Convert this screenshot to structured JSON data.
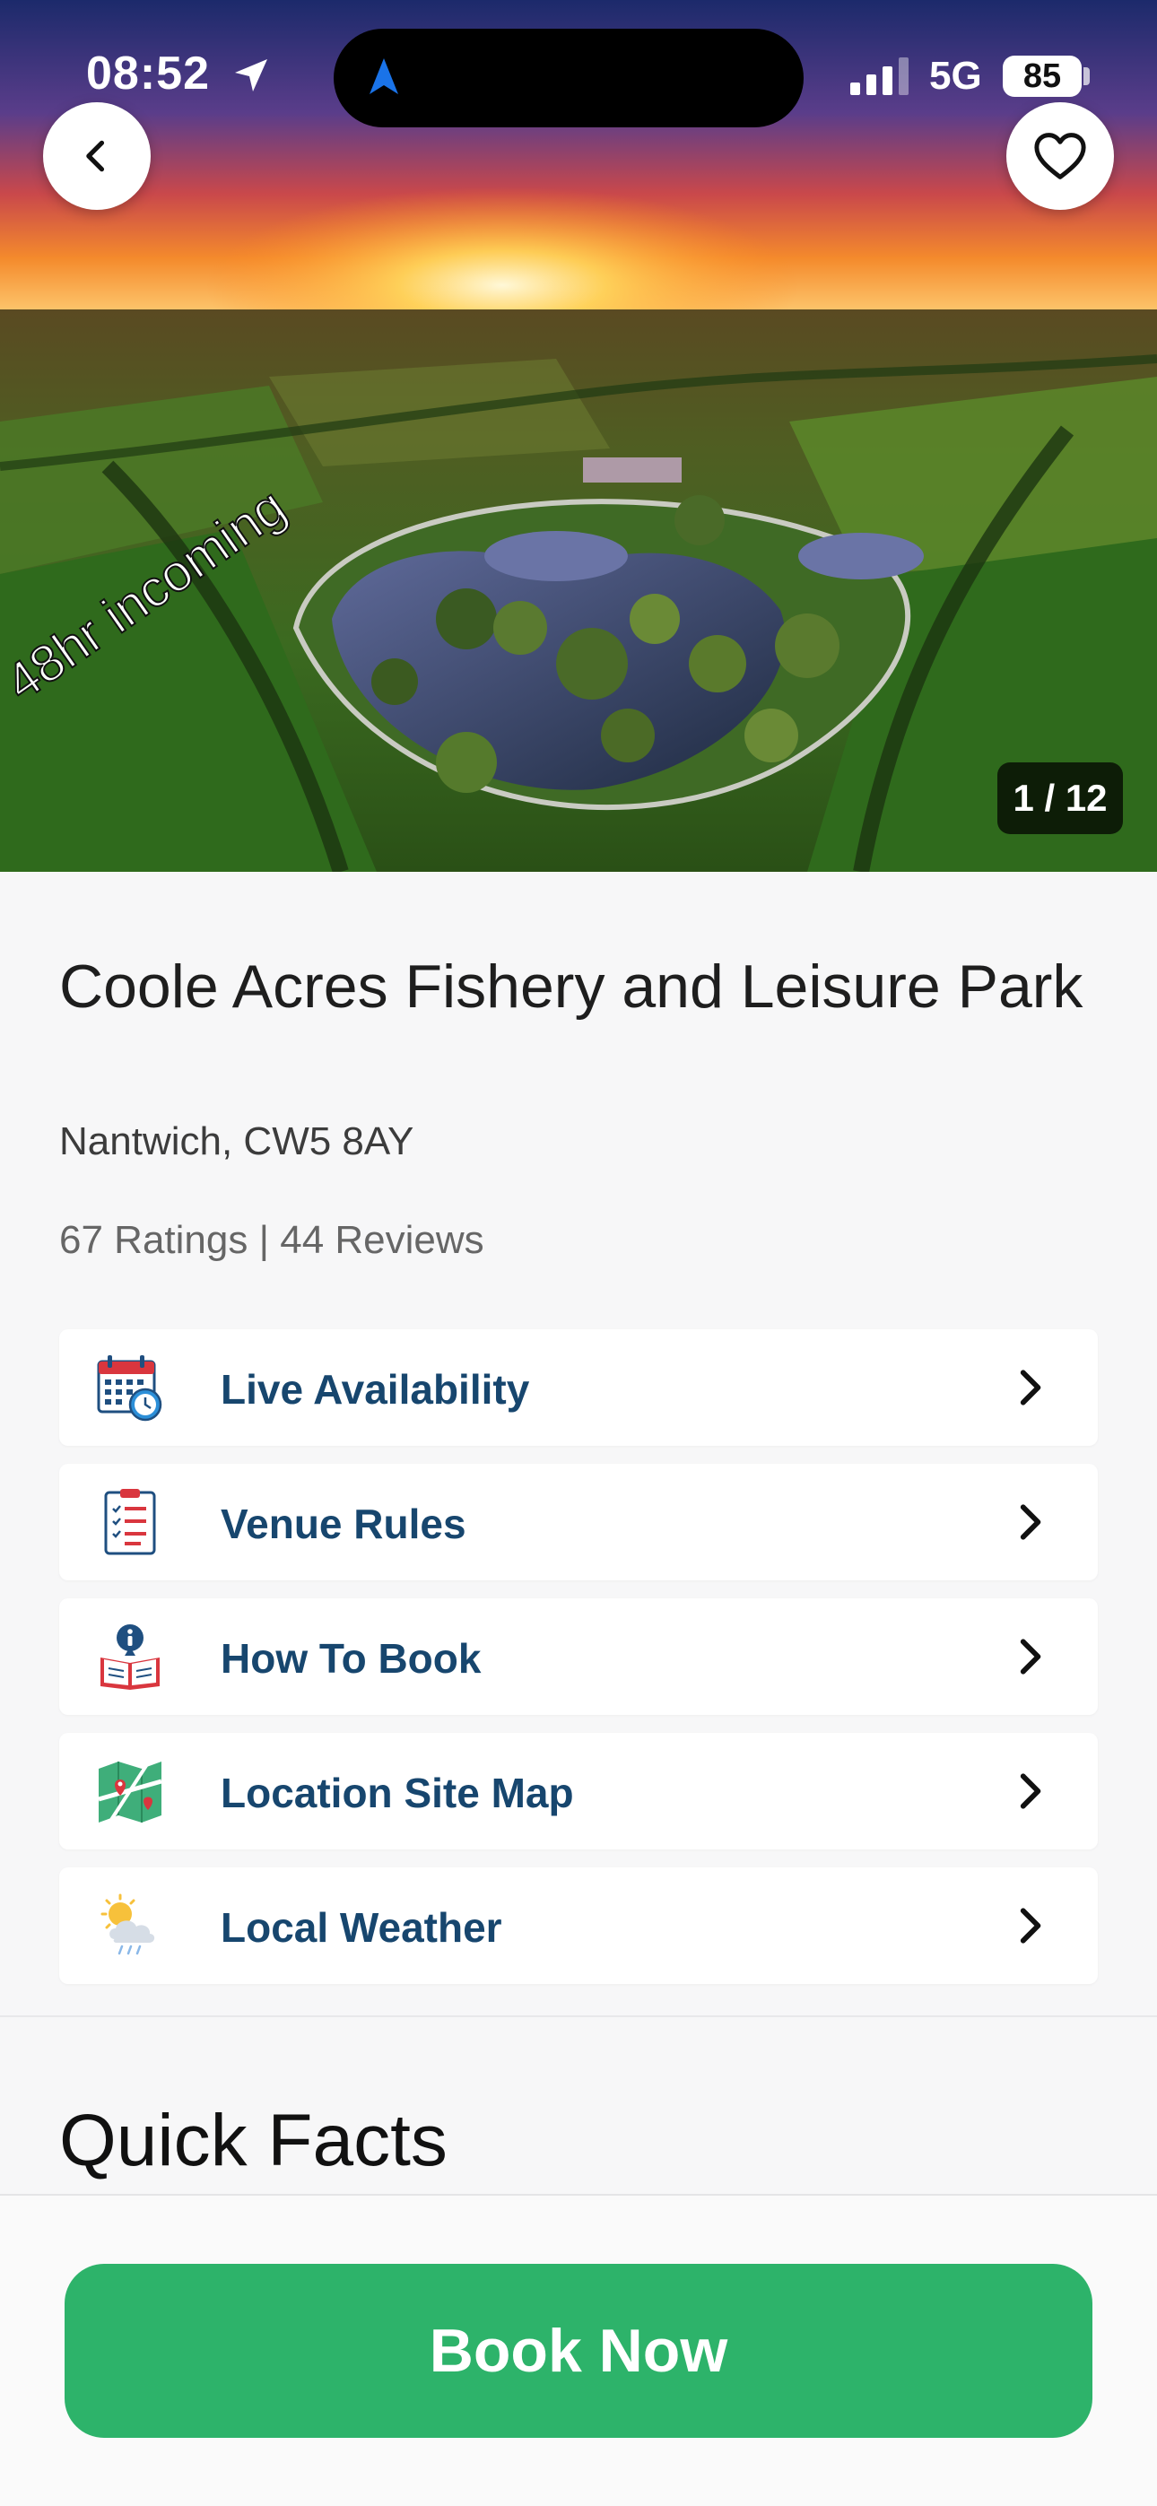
{
  "status_bar": {
    "time": "08:52",
    "network": "5G",
    "battery": "85"
  },
  "gallery": {
    "watermark": "48hr incoming",
    "counter": "1 / 12"
  },
  "venue": {
    "name": "Coole Acres Fishery and Leisure Park",
    "address": "Nantwich, CW5 8AY",
    "ratings_summary": "67 Ratings | 44 Reviews"
  },
  "menu": [
    {
      "label": "Live Availability",
      "icon": "calendar-clock-icon"
    },
    {
      "label": "Venue Rules",
      "icon": "clipboard-checklist-icon"
    },
    {
      "label": "How To Book",
      "icon": "info-book-icon"
    },
    {
      "label": "Location Site Map",
      "icon": "map-pin-icon"
    },
    {
      "label": "Local Weather",
      "icon": "sun-cloud-rain-icon"
    }
  ],
  "quick_facts": {
    "heading": "Quick Facts"
  },
  "footer": {
    "book_label": "Book Now"
  },
  "colors": {
    "brand_green": "#2db36a",
    "menu_text": "#17466e",
    "background": "#f7f7f8"
  }
}
